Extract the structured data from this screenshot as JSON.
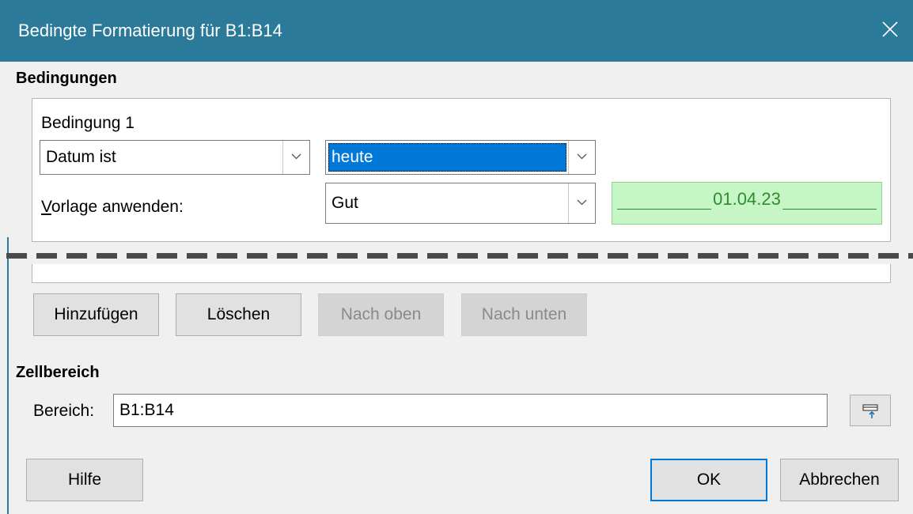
{
  "window": {
    "title": "Bedingte Formatierung für B1:B14"
  },
  "conditions": {
    "section_title": "Bedingungen",
    "condition_label": "Bedingung 1",
    "type_value": "Datum ist",
    "date_value": "heute",
    "style_label": "Vorlage anwenden:",
    "style_value": "Gut",
    "preview_text": "01.04.23"
  },
  "actions": {
    "add": "Hinzufügen",
    "delete": "Löschen",
    "up": "Nach oben",
    "down": "Nach unten"
  },
  "cell_range": {
    "section_title": "Zellbereich",
    "label": "Bereich:",
    "value": "B1:B14"
  },
  "footer": {
    "help": "Hilfe",
    "ok": "OK",
    "cancel": "Abbrechen"
  },
  "colors": {
    "titlebar": "#2b7a99",
    "selection": "#0078d7",
    "preview_background": "#c6f6c6",
    "preview_text": "#2e8b2e"
  }
}
